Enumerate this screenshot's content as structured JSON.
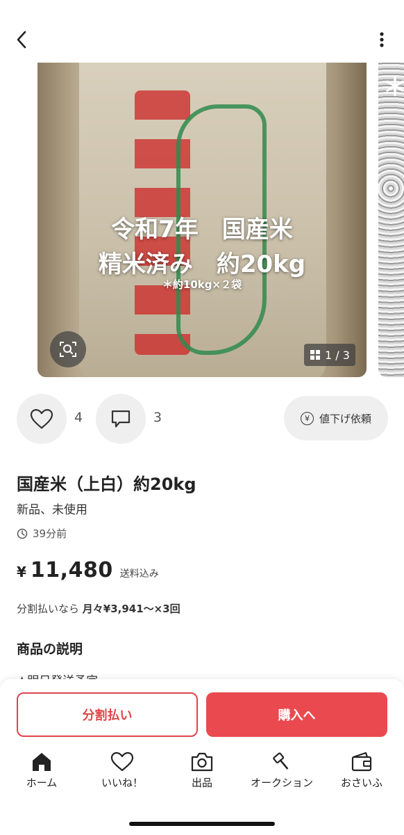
{
  "header": {
    "back_icon": "chevron-left-icon",
    "more_icon": "vertical-ellipsis-icon"
  },
  "gallery": {
    "overlay_line1": "令和7年　国産米",
    "overlay_line2": "精米済み　約20kg",
    "overlay_line3": "＊約10kg×２袋",
    "counter": "1 / 3",
    "lens_icon": "image-search-icon"
  },
  "actions": {
    "like_count": "4",
    "comment_count": "3",
    "price_request_label": "値下げ依頼"
  },
  "product": {
    "title": "国産米（上白）約20kg",
    "condition": "新品、未使用",
    "posted": "39分前",
    "currency": "¥",
    "price": "11,480",
    "shipping": "送料込み",
    "installment_prefix": "分割払いなら",
    "installment_value": "月々¥3,941〜×3回"
  },
  "description": {
    "heading": "商品の説明",
    "peek": "★明日発送予定"
  },
  "buttons": {
    "split_pay": "分割払い",
    "buy": "購入へ"
  },
  "tabs": [
    {
      "label": "ホーム",
      "icon": "home-icon"
    },
    {
      "label": "いいね！",
      "icon": "heart-icon"
    },
    {
      "label": "出品",
      "icon": "camera-icon"
    },
    {
      "label": "オークション",
      "icon": "gavel-icon"
    },
    {
      "label": "おさいふ",
      "icon": "wallet-icon"
    }
  ],
  "colors": {
    "accent": "#ea4a4f"
  }
}
